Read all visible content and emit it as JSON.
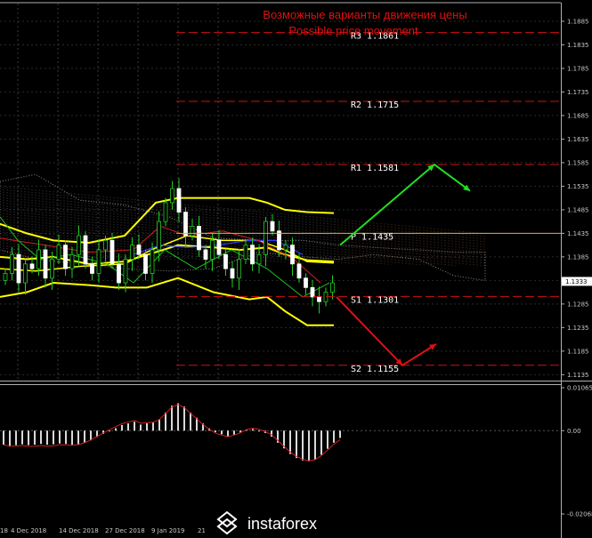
{
  "chart_data": {
    "type": "candlestick",
    "title_ru": "Возможные варианты движения цены",
    "title_en": "Possible price movement",
    "y_ticks": [
      "1.1885",
      "1.1835",
      "1.1785",
      "1.1735",
      "1.1685",
      "1.1635",
      "1.1585",
      "1.1535",
      "1.1485",
      "1.1435",
      "1.1385",
      "1.1335",
      "1.1285",
      "1.1235",
      "1.1185",
      "1.1135"
    ],
    "ylim": [
      1.113,
      1.19
    ],
    "current_price": "1.1333",
    "x_labels": [
      "18",
      "4 Dec 2018",
      "14 Dec 2018",
      "27 Dec 2018",
      "9 Jan 2019",
      "21 Jan"
    ],
    "levels": [
      {
        "name": "R3",
        "value": "1.1861"
      },
      {
        "name": "R2",
        "value": "1.1715"
      },
      {
        "name": "R1",
        "value": "1.1581"
      },
      {
        "name": "P",
        "value": "1.1435"
      },
      {
        "name": "S1",
        "value": "1.1301"
      },
      {
        "name": "S2",
        "value": "1.1155"
      }
    ],
    "close_prices": [
      1.135,
      1.139,
      1.133,
      1.137,
      1.136,
      1.14,
      1.134,
      1.138,
      1.141,
      1.136,
      1.139,
      1.143,
      1.137,
      1.135,
      1.14,
      1.142,
      1.137,
      1.133,
      1.138,
      1.141,
      1.139,
      1.135,
      1.14,
      1.146,
      1.15,
      1.153,
      1.148,
      1.143,
      1.145,
      1.14,
      1.138,
      1.142,
      1.139,
      1.136,
      1.134,
      1.138,
      1.141,
      1.137,
      1.139,
      1.146,
      1.144,
      1.14,
      1.141,
      1.137,
      1.134,
      1.132,
      1.13,
      1.129,
      1.131,
      1.133
    ],
    "scenarios": [
      {
        "color": "#22dd22",
        "points": [
          [
            1.1315,
            "start"
          ],
          [
            1.1581,
            "R1"
          ],
          [
            1.153,
            "after"
          ]
        ]
      },
      {
        "color": "#dd1111",
        "points": [
          [
            1.13,
            "start"
          ],
          [
            1.1155,
            "S2"
          ],
          [
            1.121,
            "after"
          ]
        ]
      }
    ],
    "macd_ticks": [
      "0.01065",
      "0.00",
      "-0.02068"
    ],
    "macd_ylim": [
      -0.02068,
      0.01065
    ],
    "macd_values": [
      -0.0035,
      -0.0038,
      -0.0036,
      -0.0034,
      -0.0036,
      -0.0035,
      -0.0033,
      -0.0035,
      -0.0034,
      -0.0032,
      -0.0033,
      -0.0035,
      -0.0034,
      -0.003,
      -0.0024,
      -0.0016,
      -0.0008,
      0.0,
      0.0006,
      0.0014,
      0.0018,
      0.0022,
      0.0015,
      0.0018,
      0.002,
      0.0028,
      0.0045,
      0.0062,
      0.0068,
      0.006,
      0.0045,
      0.0032,
      0.0018,
      0.0006,
      -0.0004,
      -0.0009,
      -0.0014,
      -0.001,
      -0.0005,
      0.0002,
      0.0004,
      0.0,
      -0.0006,
      -0.0015,
      -0.003,
      -0.0044,
      -0.0058,
      -0.0068,
      -0.0074,
      -0.0076,
      -0.0072,
      -0.006,
      -0.0045,
      -0.003,
      -0.0018
    ],
    "brand": "instaforex"
  }
}
